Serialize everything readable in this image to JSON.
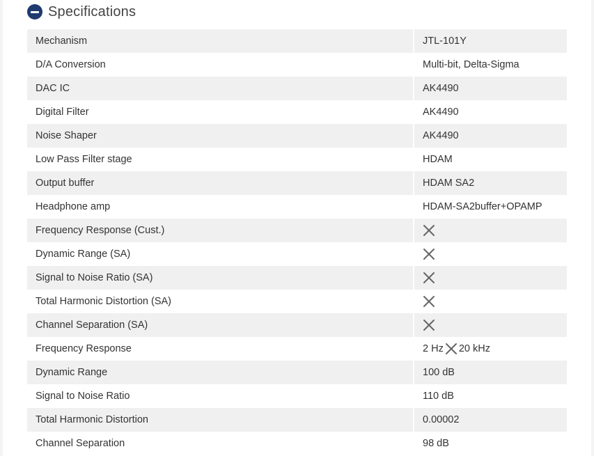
{
  "section": {
    "title": "Specifications",
    "icon": "minus-circle-icon",
    "accent_color": "#1e3a6e"
  },
  "specs": [
    {
      "label": "Mechanism",
      "value": "JTL-101Y"
    },
    {
      "label": "D/A Conversion",
      "value": "Multi-bit, Delta-Sigma"
    },
    {
      "label": "DAC IC",
      "value": "AK4490"
    },
    {
      "label": "Digital Filter",
      "value": "AK4490"
    },
    {
      "label": "Noise Shaper",
      "value": "AK4490"
    },
    {
      "label": "Low Pass Filter stage",
      "value": "HDAM"
    },
    {
      "label": "Output buffer",
      "value": "HDAM SA2"
    },
    {
      "label": "Headphone amp",
      "value": "HDAM-SA2buffer+OPAMP"
    },
    {
      "label": "Frequency Response (Cust.)",
      "value": null,
      "icon": "x-icon"
    },
    {
      "label": "Dynamic Range (SA)",
      "value": null,
      "icon": "x-icon"
    },
    {
      "label": "Signal to Noise Ratio (SA)",
      "value": null,
      "icon": "x-icon"
    },
    {
      "label": "Total Harmonic Distortion (SA)",
      "value": null,
      "icon": "x-icon"
    },
    {
      "label": "Channel Separation (SA)",
      "value": null,
      "icon": "x-icon"
    },
    {
      "label": "Frequency Response",
      "value_from": "2 Hz",
      "value_to": "20 kHz",
      "icon": "x-icon"
    },
    {
      "label": "Dynamic Range",
      "value": "100 dB"
    },
    {
      "label": "Signal to Noise Ratio",
      "value": "110 dB"
    },
    {
      "label": "Total Harmonic Distortion",
      "value": "0.00002"
    },
    {
      "label": "Channel Separation",
      "value": "98 dB"
    }
  ]
}
